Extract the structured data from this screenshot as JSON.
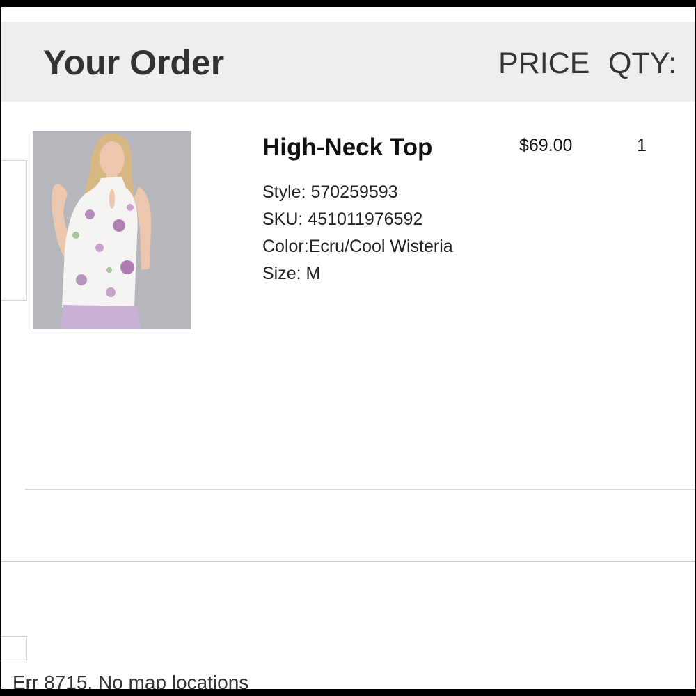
{
  "order": {
    "title": "Your Order",
    "price_header": "PRICE",
    "qty_header": "QTY:"
  },
  "item": {
    "name": "High-Neck Top",
    "price": "$69.00",
    "quantity": "1",
    "style": "Style: 570259593",
    "sku": "SKU: 451011976592",
    "color": "Color:Ecru/Cool Wisteria",
    "size": "Size:  M"
  },
  "status": {
    "error_message": "Err 8715. No map locations"
  }
}
